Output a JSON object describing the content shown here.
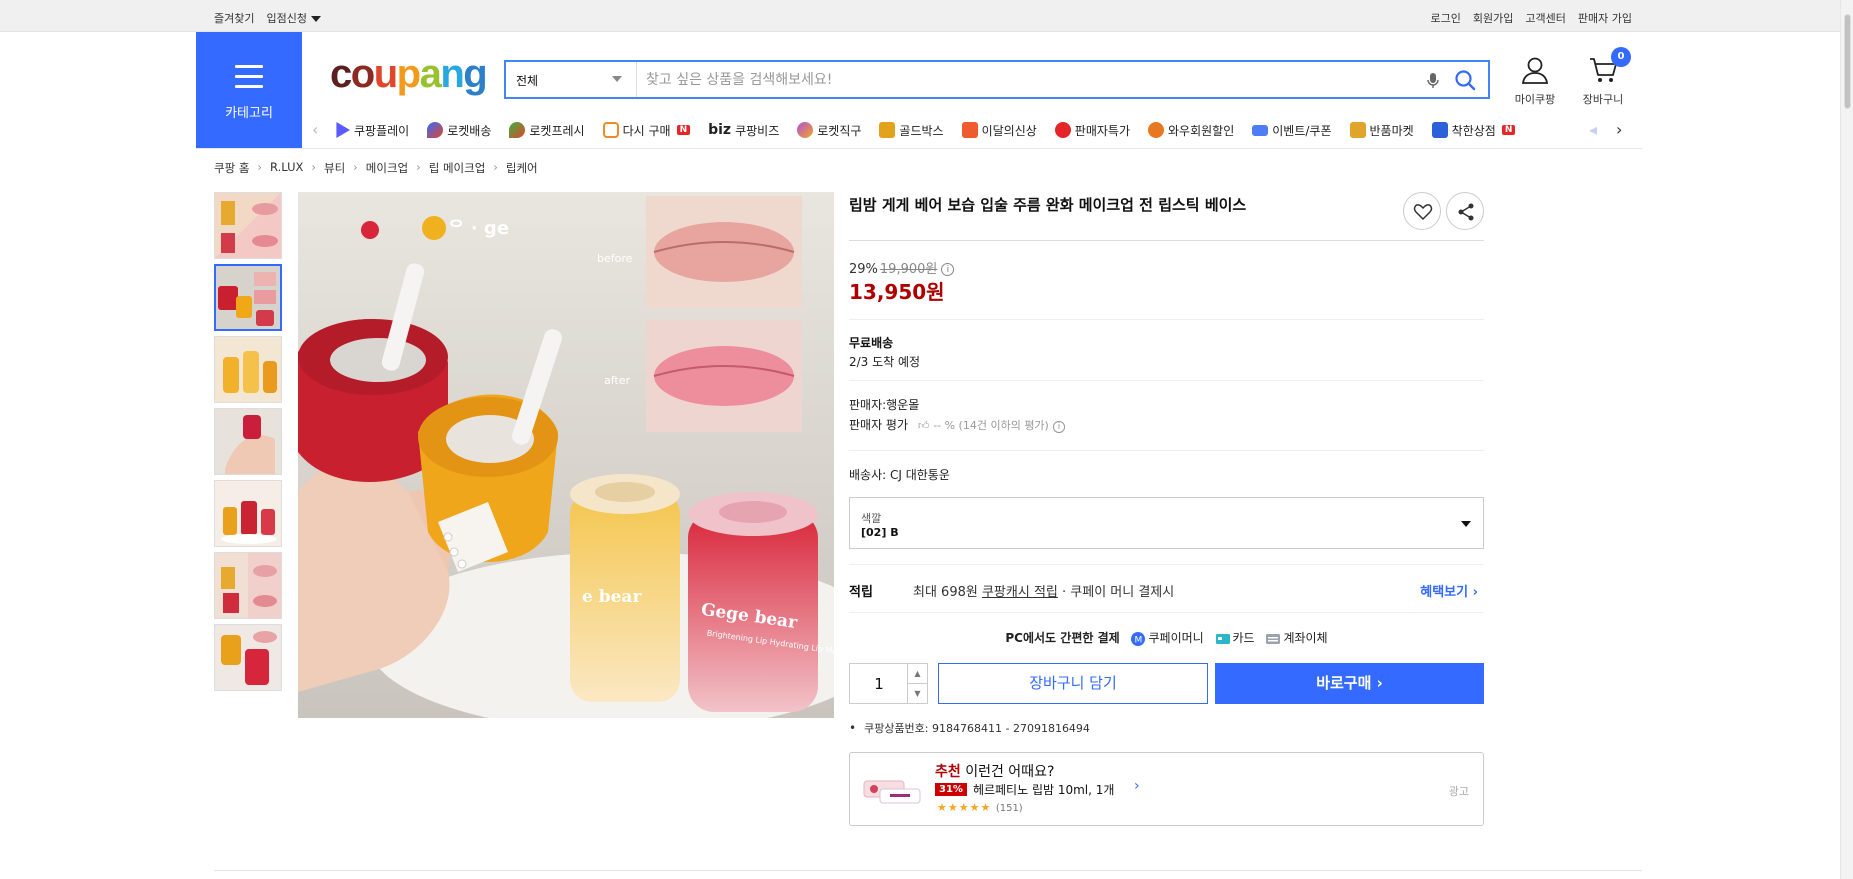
{
  "topbar": {
    "bookmark": "즐겨찾기",
    "apply": "입점신청",
    "login": "로그인",
    "signup": "회원가입",
    "support": "고객센터",
    "seller_signup": "판매자 가입"
  },
  "header": {
    "category_label": "카테고리",
    "logo_letters": [
      "c",
      "o",
      "u",
      "p",
      "a",
      "n",
      "g"
    ],
    "search_scope": "전체",
    "search_placeholder": "찾고 싶은 상품을 검색해보세요!",
    "mypage": "마이쿠팡",
    "cart": "장바구니",
    "cart_count": "0"
  },
  "nav": {
    "items": [
      {
        "label": "쿠팡플레이",
        "icon": "play-icon",
        "color": "#5b5bff"
      },
      {
        "label": "로켓배송",
        "icon": "rocket-icon",
        "color": "#346aff"
      },
      {
        "label": "로켓프레시",
        "icon": "rocket-fresh-icon",
        "color": "#3cb043"
      },
      {
        "label": "다시 구매",
        "icon": "rebuy-icon",
        "color": "#f08a24",
        "badge": "N"
      },
      {
        "label": "쿠팡비즈",
        "prefix": "biz",
        "icon": "biz-icon",
        "color": "#111111"
      },
      {
        "label": "로켓직구",
        "icon": "rocket-global-icon",
        "color": "#b04fd8"
      },
      {
        "label": "골드박스",
        "icon": "goldbox-icon",
        "color": "#e2a21b"
      },
      {
        "label": "이달의신상",
        "icon": "new-icon",
        "color": "#ef5a2e"
      },
      {
        "label": "판매자특가",
        "icon": "seller-deal-icon",
        "color": "#e52528"
      },
      {
        "label": "와우회원할인",
        "icon": "wow-icon",
        "color": "#e87722"
      },
      {
        "label": "이벤트/쿠폰",
        "icon": "coupon-icon",
        "color": "#4d7cf5"
      },
      {
        "label": "반품마켓",
        "icon": "return-market-icon",
        "color": "#e0a42a"
      },
      {
        "label": "착한상점",
        "icon": "good-store-icon",
        "color": "#2b62d9",
        "badge": "N"
      }
    ]
  },
  "breadcrumb": [
    "쿠팡 홈",
    "R.LUX",
    "뷰티",
    "메이크업",
    "립 메이크업",
    "립케어"
  ],
  "gallery": {
    "before_label": "before",
    "after_label": "after",
    "jar_brand": "Gege bear",
    "jar_sub": "Brightening Lip Hydrating Lip Mask",
    "sticker_text": "ᄋ · ge"
  },
  "product": {
    "title": "립밤 게게 베어 보습 입술 주름 완화 메이크업 전 립스틱 베이스",
    "discount_rate": "29%",
    "original_price": "19,900원",
    "info_mark": "i",
    "price": "13,950원",
    "shipping_title": "무료배송",
    "delivery_date": "2/3 도착 예정",
    "seller": "판매자:행운몰",
    "seller_rating_label": "판매자 평가",
    "seller_rating_value": "-- % (14건 이하의 평가)",
    "courier": "배송사:  CJ 대한통운",
    "option_label": "색깔",
    "option_value": "[02] B",
    "reward_label": "적립",
    "reward_prefix": "최대 698원 ",
    "reward_link": "쿠팡캐시 적립",
    "reward_suffix": " · 쿠페이 머니 결제시",
    "reward_more": "혜택보기 ›",
    "pay_title": "PC에서도 간편한 결제",
    "pay_methods": [
      "쿠페이머니",
      "카드",
      "계좌이체"
    ],
    "quantity": "1",
    "add_to_cart": "장바구니 담기",
    "buy_now": "바로구매 ›",
    "product_number": "쿠팡상품번호: 9184768411 - 27091816494"
  },
  "recommend": {
    "headline_accent": "추천",
    "headline_rest": " 이런건 어때요?",
    "discount": "31%",
    "name": "헤르페티노 립밤 10ml, 1개",
    "stars": "★★★★★",
    "review_count": "(151)",
    "ad_label": "광고"
  },
  "colors": {
    "accent": "#346aff",
    "price": "#ae0000"
  }
}
